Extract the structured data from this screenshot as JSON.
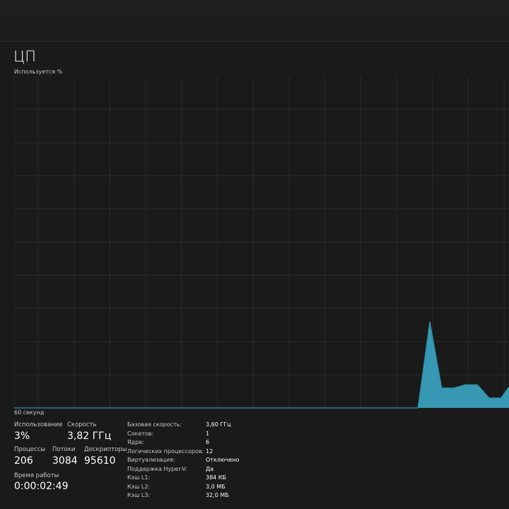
{
  "header": {
    "title": "ЦП",
    "subtitle": "Используется %"
  },
  "graph": {
    "type": "area",
    "y_range": [
      0,
      100
    ],
    "x_label": "60 секунд",
    "color": "#3aa6c4",
    "values": [
      0,
      0,
      0,
      0,
      0,
      0,
      0,
      0,
      0,
      0,
      0,
      0,
      0,
      0,
      0,
      0,
      0,
      0,
      0,
      0,
      0,
      0,
      0,
      0,
      0,
      0,
      0,
      0,
      0,
      0,
      0,
      0,
      0,
      0,
      0,
      26,
      6,
      6,
      7,
      7,
      3,
      3,
      8
    ]
  },
  "stats": {
    "usage": {
      "label": "Использование",
      "value": "3%"
    },
    "speed": {
      "label": "Скорость",
      "value": "3,82 ГГц"
    },
    "processes": {
      "label": "Процессы",
      "value": "206"
    },
    "threads": {
      "label": "Потоки",
      "value": "3084"
    },
    "handles": {
      "label": "Дескрипторы",
      "value": "95610"
    },
    "uptime": {
      "label": "Время работы",
      "value": "0:00:02:49"
    }
  },
  "details": [
    {
      "key": "Базовая скорость:",
      "value": "3,60 ГГц"
    },
    {
      "key": "Сокетов:",
      "value": "1"
    },
    {
      "key": "Ядра:",
      "value": "6"
    },
    {
      "key": "Логических процессоров:",
      "value": "12"
    },
    {
      "key": "Виртуализация:",
      "value": "Отключено"
    },
    {
      "key": "Поддержка Hyper-V:",
      "value": "Да"
    },
    {
      "key": "Кэш L1:",
      "value": "384 КБ"
    },
    {
      "key": "Кэш L2:",
      "value": "3,0 МБ"
    },
    {
      "key": "Кэш L3:",
      "value": "32,0 МБ"
    }
  ]
}
